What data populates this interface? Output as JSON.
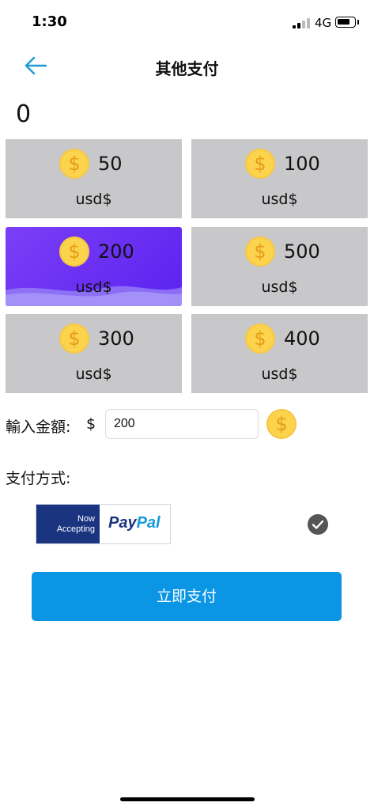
{
  "status_bar": {
    "time": "1:30",
    "network": "4G",
    "battery_level": 0.8
  },
  "header": {
    "title": "其他支付",
    "back_icon": "arrow-left-icon",
    "accent": "#1a9ad6"
  },
  "balance": "0",
  "options": [
    {
      "amount": "50",
      "unit": "usd$",
      "selected": false
    },
    {
      "amount": "100",
      "unit": "usd$",
      "selected": false
    },
    {
      "amount": "200",
      "unit": "usd$",
      "selected": true
    },
    {
      "amount": "500",
      "unit": "usd$",
      "selected": false
    },
    {
      "amount": "300",
      "unit": "usd$",
      "selected": false
    },
    {
      "amount": "400",
      "unit": "usd$",
      "selected": false
    }
  ],
  "coin_symbol": "$",
  "amount_input": {
    "label": "輸入金額:",
    "currency": "$",
    "value": "200"
  },
  "payment": {
    "label": "支付方式:",
    "paypal": {
      "line1": "Now",
      "line2": "Accepting",
      "brand1": "Pay",
      "brand2": "Pal"
    },
    "selected": true
  },
  "pay_button": "立即支付",
  "colors": {
    "selected_card": "#6a30f3",
    "card": "#c8c8ca",
    "pay_button": "#0b96e5",
    "coin": "#fcd34d"
  }
}
